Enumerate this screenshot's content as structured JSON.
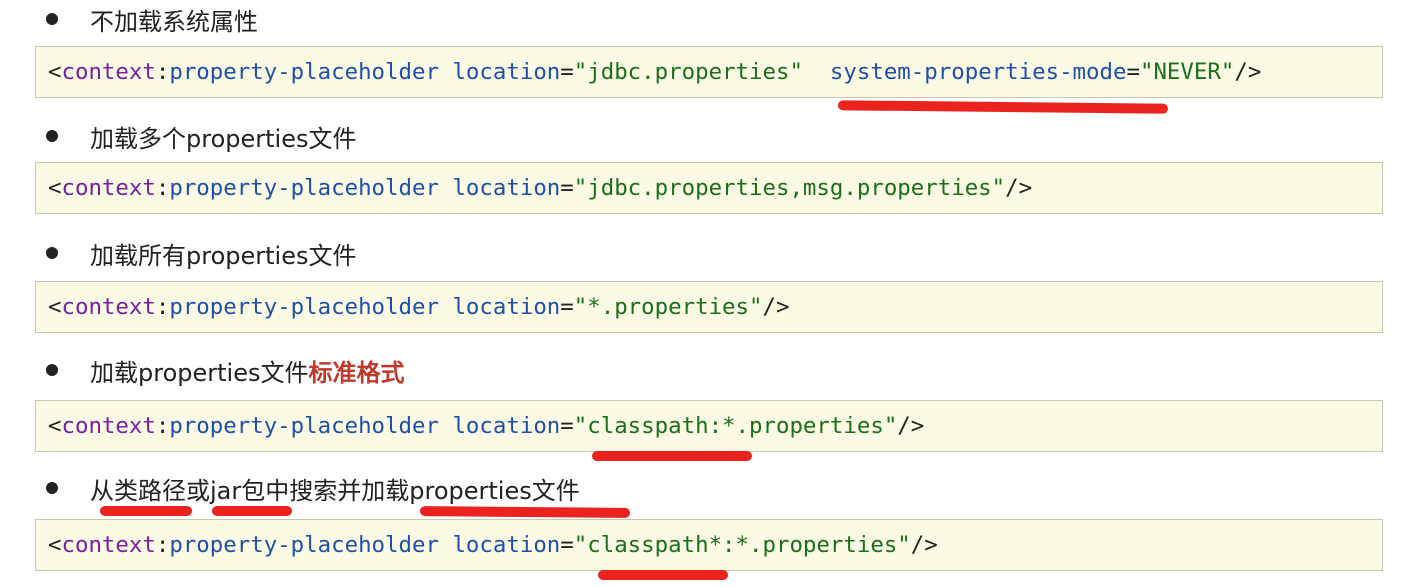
{
  "items": [
    {
      "bullet": "不加载系统属性",
      "code": {
        "ns": "context",
        "tag": "property-placeholder",
        "attrs": [
          {
            "name": "location",
            "value": "\"jdbc.properties\""
          },
          {
            "name": "system-properties-mode",
            "value": "\"NEVER\""
          }
        ],
        "end": "/>"
      }
    },
    {
      "bullet": "加载多个properties文件",
      "code": {
        "ns": "context",
        "tag": "property-placeholder",
        "attrs": [
          {
            "name": "location",
            "value": "\"jdbc.properties,msg.properties\""
          }
        ],
        "end": "/>"
      }
    },
    {
      "bullet": "加载所有properties文件",
      "code": {
        "ns": "context",
        "tag": "property-placeholder",
        "attrs": [
          {
            "name": "location",
            "value": "\"*.properties\""
          }
        ],
        "end": "/>"
      }
    },
    {
      "bullet": "加载properties文件",
      "bullet_emphasis": "标准格式",
      "code": {
        "ns": "context",
        "tag": "property-placeholder",
        "attrs": [
          {
            "name": "location",
            "value": "\"classpath:*.properties\""
          }
        ],
        "end": "/>"
      }
    },
    {
      "bullet": "从类路径或jar包中搜索并加载properties文件",
      "code": {
        "ns": "context",
        "tag": "property-placeholder",
        "attrs": [
          {
            "name": "location",
            "value": "\"classpath*:*.properties\""
          }
        ],
        "end": "/>"
      }
    }
  ],
  "colors": {
    "code_background": "#fbfbe5",
    "annotation_red": "#e8100c",
    "emphasis_red": "#c0392b"
  }
}
